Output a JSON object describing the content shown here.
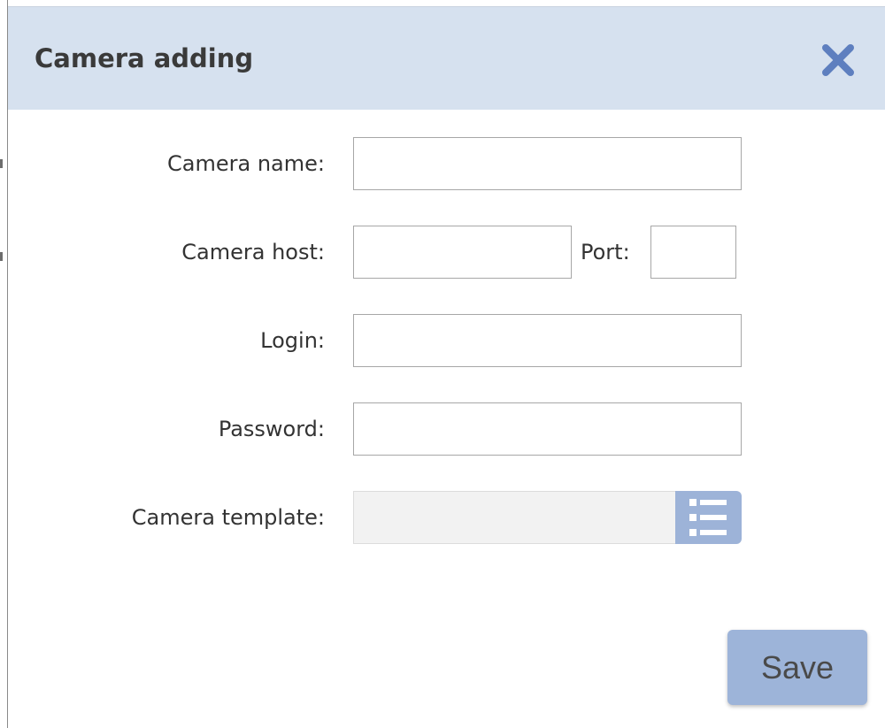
{
  "dialog": {
    "title": "Camera adding",
    "close_icon": "close-icon",
    "accent_color": "#d6e1ef",
    "button_color": "#9db4d9"
  },
  "form": {
    "camera_name": {
      "label": "Camera name:",
      "value": ""
    },
    "camera_host": {
      "label": "Camera host:",
      "value": ""
    },
    "port": {
      "label": "Port:",
      "value": ""
    },
    "login": {
      "label": "Login:",
      "value": ""
    },
    "password": {
      "label": "Password:",
      "value": ""
    },
    "camera_template": {
      "label": "Camera template:",
      "value": "",
      "picker_icon": "list-icon"
    }
  },
  "footer": {
    "save_label": "Save"
  }
}
